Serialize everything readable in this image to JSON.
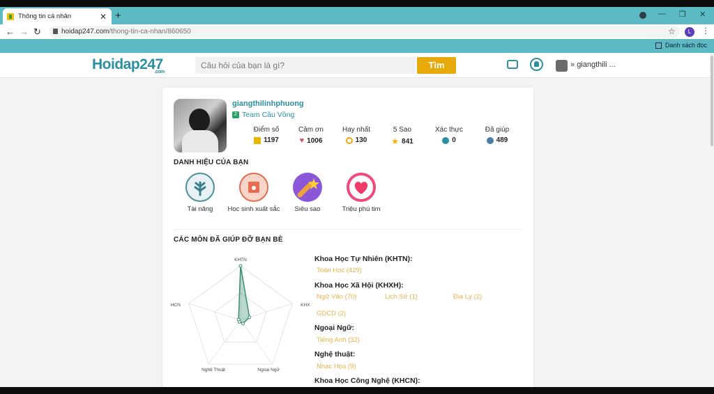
{
  "browser": {
    "tab_title": "Thông tin cá nhân",
    "tab_close": "✕",
    "new_tab": "+",
    "url_domain": "hoidap247.com",
    "url_path": "/thong-tin-ca-nhan/860650",
    "profile_initial": "L",
    "reading_list": "Danh sách đọc",
    "win_min": "—",
    "win_restore": "❐",
    "win_close": "✕"
  },
  "site": {
    "logo_main": "Hoidap247",
    "logo_suffix": ".com",
    "search_placeholder": "Câu hỏi của bạn là gì?",
    "search_button": "Tìm",
    "user_name": "giangthili ..."
  },
  "profile": {
    "username": "giangthilinhphuong",
    "team": "Team Cầu Vồng",
    "stats": [
      {
        "label": "Điểm số",
        "value": "1197",
        "icon": "points-icon",
        "color": "#e8b800"
      },
      {
        "label": "Cảm ơn",
        "value": "1006",
        "icon": "heart-icon",
        "color": "#d94c5c"
      },
      {
        "label": "Hay nhất",
        "value": "130",
        "icon": "medal-icon",
        "color": "#e8a90b"
      },
      {
        "label": "5 Sao",
        "value": "841",
        "icon": "star-icon",
        "color": "#f3b400"
      },
      {
        "label": "Xác thực",
        "value": "0",
        "icon": "verified-icon",
        "color": "#2a8fa0"
      },
      {
        "label": "Đã giúp",
        "value": "489",
        "icon": "helped-icon",
        "color": "#4a7fa8"
      }
    ]
  },
  "titles_section": {
    "heading": "DANH HIỆU CỦA BẠN",
    "badges": [
      {
        "label": "Tài năng",
        "icon": "talent-badge-icon"
      },
      {
        "label": "Học sinh xuất sắc",
        "icon": "excellent-student-badge-icon"
      },
      {
        "label": "Siêu sao",
        "icon": "superstar-badge-icon"
      },
      {
        "label": "Triệu phú tim",
        "icon": "heart-millionaire-badge-icon"
      }
    ]
  },
  "subjects_section": {
    "heading": "CÁC MÔN ĐÃ GIÚP ĐỠ BẠN BÈ",
    "radar_axes": [
      "KHTN",
      "KHXH",
      "Ngoại Ngữ",
      "Nghệ Thuật",
      "KHCN"
    ],
    "radar_values": [
      429,
      74,
      32,
      9,
      0
    ],
    "categories": [
      {
        "name": "Khoa Học Tự Nhiên (KHTN):",
        "subjects": [
          "Toán Học (429)"
        ]
      },
      {
        "name": "Khoa Học Xã Hội (KHXH):",
        "subjects": [
          "Ngữ Văn (70)",
          "Lịch Sử (1)",
          "Địa Lý (2)",
          "GDCD (2)"
        ]
      },
      {
        "name": "Ngoại Ngữ:",
        "subjects": [
          "Tiếng Anh (32)"
        ]
      },
      {
        "name": "Nghệ thuật:",
        "subjects": [
          "Nhạc Họa (9)"
        ]
      },
      {
        "name": "Khoa Học Công Nghệ (KHCN):",
        "subjects": []
      }
    ]
  }
}
